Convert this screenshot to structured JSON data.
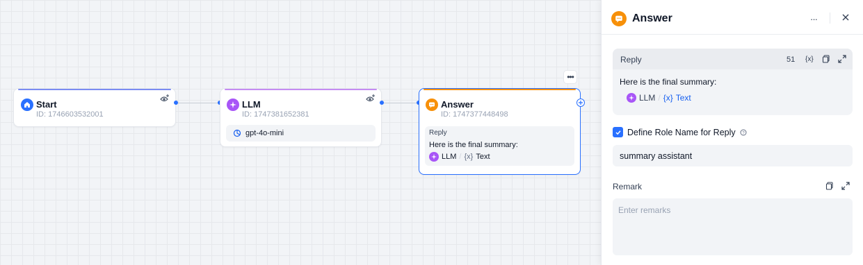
{
  "canvas": {
    "start_node": {
      "title": "Start",
      "id_text": "ID: 1746603532001",
      "accent": "#7b8cf2",
      "icon_color": "#2970ff"
    },
    "llm_node": {
      "title": "LLM",
      "id_text": "ID: 1747381652381",
      "model": "gpt-4o-mini",
      "accent": "#c58cf2",
      "icon_color": "#a855f7"
    },
    "answer_node": {
      "title": "Answer",
      "id_text": "ID: 1747377448498",
      "reply_label": "Reply",
      "reply_text": "Here is the final summary:",
      "var_source": "LLM",
      "var_name": "Text",
      "var_prefix": "{x}",
      "accent": "#f79009",
      "icon_color": "#f79009"
    }
  },
  "panel": {
    "title": "Answer",
    "more_label": "···",
    "reply": {
      "label": "Reply",
      "char_count": "51",
      "var_insert_label": "{x}",
      "text": "Here is the final summary:",
      "var_source": "LLM",
      "var_prefix": "{x}",
      "var_name": "Text"
    },
    "define_role": {
      "label": "Define Role Name for Reply",
      "checked": true
    },
    "role_name_value": "summary assistant",
    "remark": {
      "label": "Remark",
      "placeholder": "Enter remarks",
      "value": ""
    }
  }
}
